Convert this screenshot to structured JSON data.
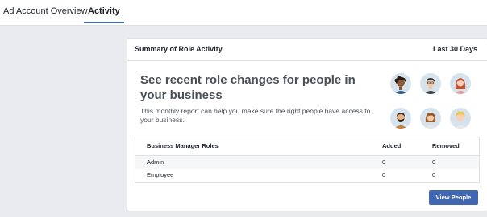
{
  "tabs": [
    {
      "label": "Ad Account Overview",
      "active": false
    },
    {
      "label": "Activity",
      "active": true
    }
  ],
  "colors": {
    "accent": "#4267b2",
    "page_background": "#e9ebee",
    "avatar_background": "#d7e3ec"
  },
  "summary": {
    "title": "Summary of Role Activity",
    "period": "Last 30 Days",
    "headline": "See recent role changes for people in your business",
    "description": "This monthly report can help you make sure the right people have access to your business.",
    "avatar_icons": [
      "person-dark-hair-icon",
      "person-glasses-icon",
      "person-red-hair-icon",
      "person-beard-icon",
      "person-woman-icon",
      "person-blond-icon"
    ]
  },
  "roles_table": {
    "headers": [
      "Business Manager Roles",
      "Added",
      "Removed"
    ],
    "rows": [
      {
        "role": "Admin",
        "added": "0",
        "removed": "0"
      },
      {
        "role": "Employee",
        "added": "0",
        "removed": "0"
      }
    ]
  },
  "view_people_button": "View People"
}
